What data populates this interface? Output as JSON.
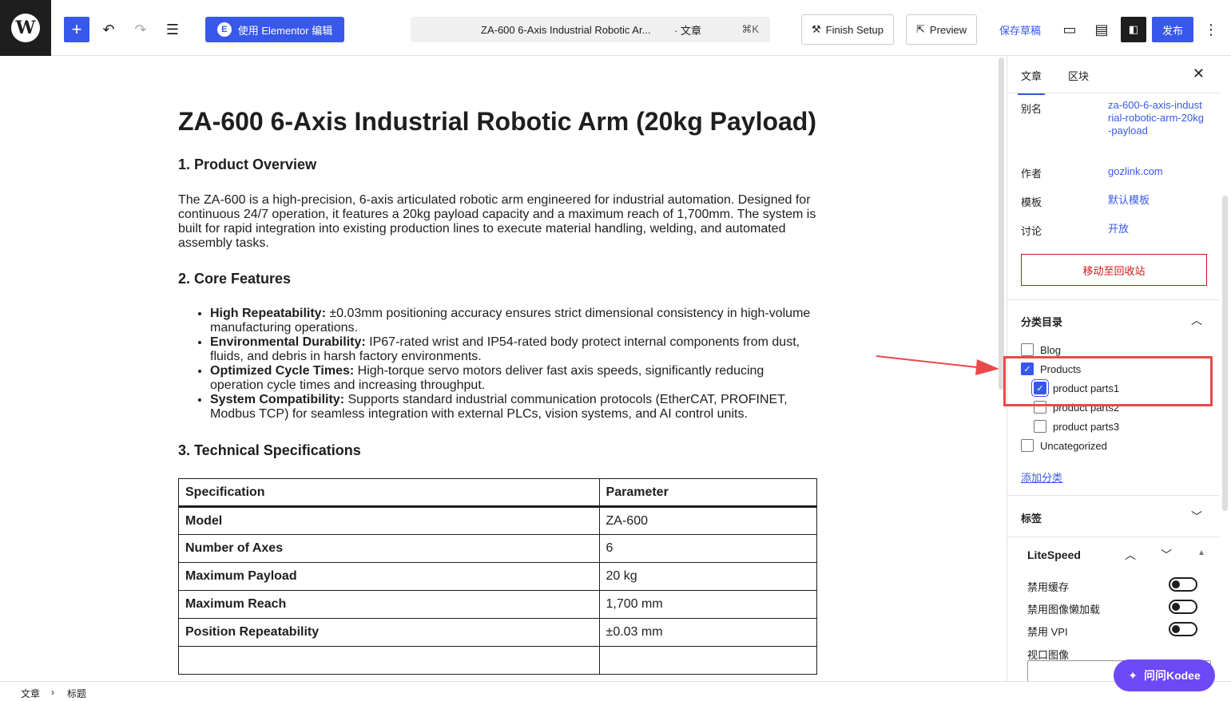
{
  "topbar": {
    "elementor_label": "使用 Elementor 编辑",
    "doc_title": "ZA-600 6-Axis Industrial Robotic Ar...",
    "doc_type": "· 文章",
    "doc_shortcut": "⌘K",
    "finish_setup": "Finish Setup",
    "preview": "Preview",
    "save_draft": "保存草稿",
    "publish": "发布"
  },
  "post": {
    "title": "ZA-600 6-Axis Industrial Robotic Arm (20kg Payload)",
    "overview_heading": "1. Product Overview",
    "overview_text": "The ZA-600 is a high-precision, 6-axis articulated robotic arm engineered for industrial automation. Designed for continuous 24/7 operation, it features a 20kg payload capacity and a maximum reach of 1,700mm. The system is built for rapid integration into existing production lines to execute material handling, welding, and automated assembly tasks.",
    "features_heading": "2. Core Features",
    "features": [
      {
        "label": "High Repeatability:",
        "text": " ±0.03mm positioning accuracy ensures strict dimensional consistency in high-volume manufacturing operations."
      },
      {
        "label": "Environmental Durability:",
        "text": " IP67-rated wrist and IP54-rated body protect internal components from dust, fluids, and debris in harsh factory environments."
      },
      {
        "label": "Optimized Cycle Times:",
        "text": " High-torque servo motors deliver fast axis speeds, significantly reducing operation cycle times and increasing throughput."
      },
      {
        "label": "System Compatibility:",
        "text": " Supports standard industrial communication protocols (EtherCAT, PROFINET, Modbus TCP) for seamless integration with external PLCs, vision systems, and AI control units."
      }
    ],
    "specs_heading": "3. Technical Specifications",
    "spec_headers": [
      "Specification",
      "Parameter"
    ],
    "spec_rows": [
      [
        "Model",
        "ZA-600"
      ],
      [
        "Number of Axes",
        "6"
      ],
      [
        "Maximum Payload",
        "20 kg"
      ],
      [
        "Maximum Reach",
        "1,700 mm"
      ],
      [
        "Position Repeatability",
        "±0.03 mm"
      ]
    ]
  },
  "sidebar": {
    "tab_post": "文章",
    "tab_block": "区块",
    "slug_label": "别名",
    "slug_value": "za-600-6-axis-industrial-robotic-arm-20kg-payload",
    "author_label": "作者",
    "author_value": "gozlink.com",
    "template_label": "模板",
    "template_value": "默认模板",
    "discussion_label": "讨论",
    "discussion_value": "开放",
    "trash": "移动至回收站",
    "categories_heading": "分类目录",
    "categories": [
      {
        "name": "Blog",
        "checked": false
      },
      {
        "name": "Products",
        "checked": true
      },
      {
        "name": "product parts1",
        "checked": true
      },
      {
        "name": "product parts2",
        "checked": false
      },
      {
        "name": "product parts3",
        "checked": false
      },
      {
        "name": "Uncategorized",
        "checked": false
      }
    ],
    "add_category": "添加分类",
    "tags_heading": "标签",
    "litespeed_heading": "LiteSpeed",
    "ls_disable_cache": "禁用缓存",
    "ls_disable_lazy": "禁用图像懒加载",
    "ls_disable_vpi": "禁用 VPI",
    "ls_viewport": "视口图像"
  },
  "footer": {
    "crumb1": "文章",
    "crumb2": "标题"
  },
  "kodee": "问问Kodee",
  "colors": {
    "accent": "#3858e9",
    "annotation": "#e84a4a",
    "danger": "#cc1818",
    "kodee": "#6c49f5"
  }
}
